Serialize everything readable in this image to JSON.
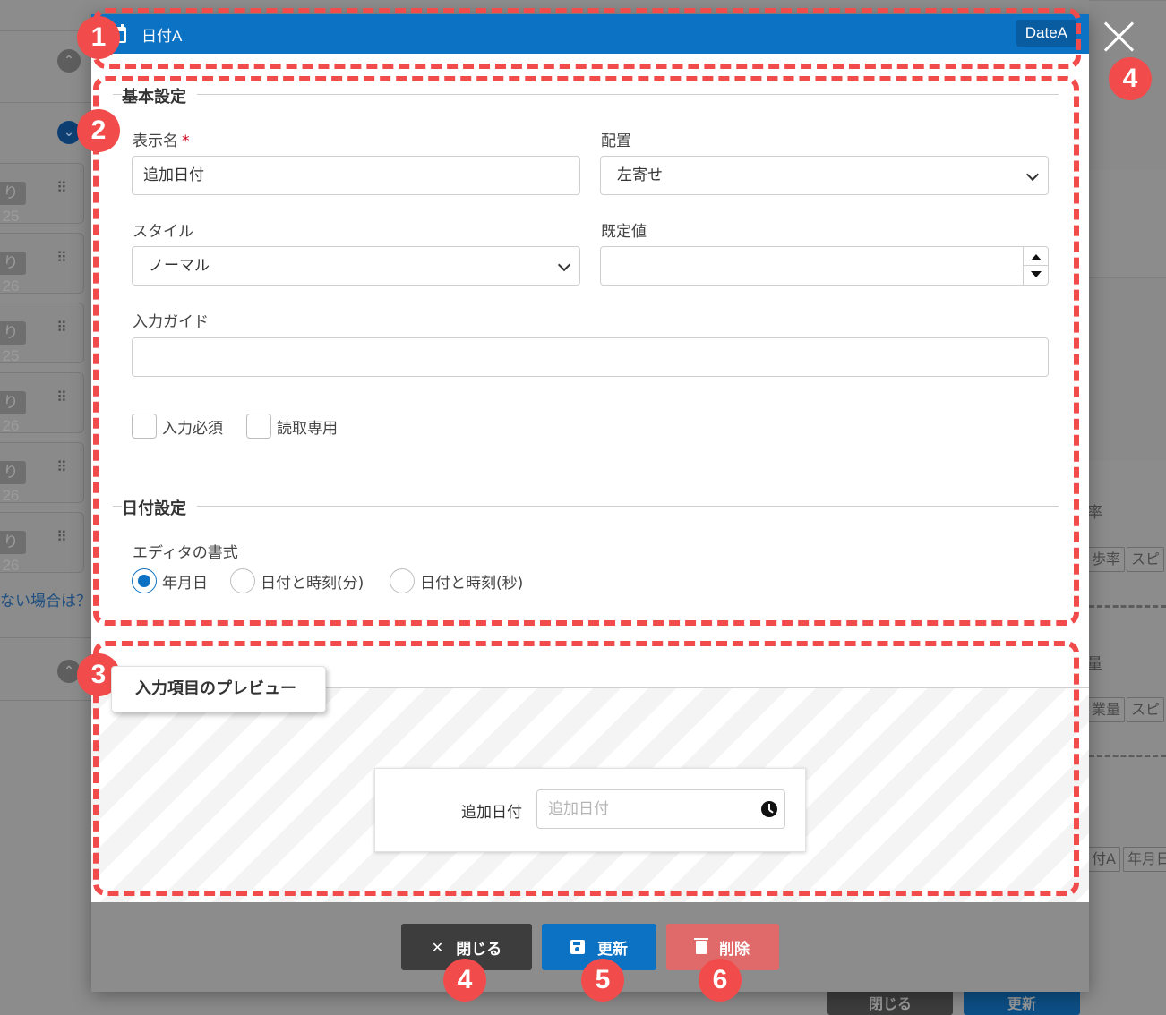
{
  "background": {
    "left_chips": [
      "り 25",
      "り 26",
      "り 25",
      "り 26",
      "り 26",
      "り 26"
    ],
    "help_link": "ない場合は？",
    "right_fragments": [
      "率",
      "歩率",
      "スピ",
      "量",
      "業量",
      "スピ",
      "付A",
      "年月日"
    ],
    "bottom_buttons": [
      "閉じる",
      "更新"
    ]
  },
  "modal": {
    "title": "日付A",
    "badge": "DateA",
    "basic": {
      "section_title": "基本設定",
      "display_name_label": "表示名",
      "required_mark": "*",
      "display_name_value": "追加日付",
      "placement_label": "配置",
      "placement_value": "左寄せ",
      "style_label": "スタイル",
      "style_value": "ノーマル",
      "default_label": "既定値",
      "default_value": "",
      "guide_label": "入力ガイド",
      "guide_value": "",
      "required_checkbox": "入力必須",
      "readonly_checkbox": "読取専用"
    },
    "date": {
      "section_title": "日付設定",
      "format_label": "エディタの書式",
      "options": [
        "年月日",
        "日付と時刻(分)",
        "日付と時刻(秒)"
      ],
      "selected": "年月日"
    },
    "preview": {
      "tab_label": "入力項目のプレビュー",
      "field_label": "追加日付",
      "field_placeholder": "追加日付"
    },
    "footer": {
      "close_label": "閉じる",
      "update_label": "更新",
      "delete_label": "削除"
    }
  },
  "annotations": {
    "markers": [
      "1",
      "2",
      "3",
      "4",
      "4",
      "5",
      "6"
    ],
    "color": "#f24b4b"
  },
  "colors": {
    "header": "#0c72c4",
    "update_button": "#0c72c4",
    "close_button": "#3d3d3d",
    "delete_button": "#e06a6a"
  }
}
